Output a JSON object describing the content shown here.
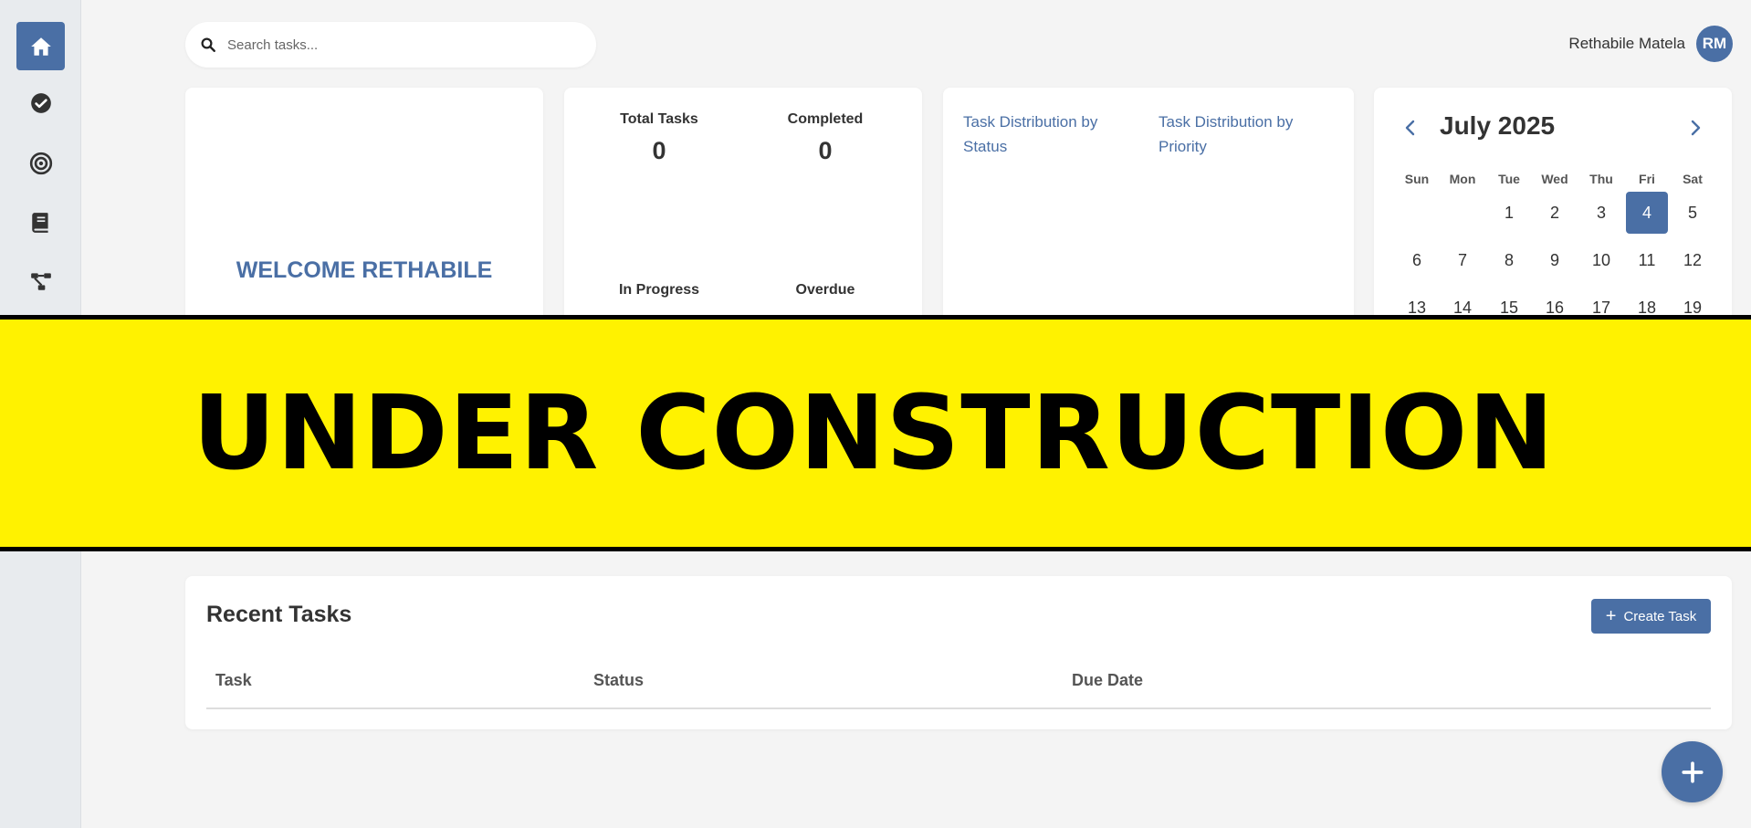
{
  "sidebar": {
    "items": [
      {
        "icon": "home-icon",
        "active": true
      },
      {
        "icon": "check-circle-icon",
        "active": false
      },
      {
        "icon": "target-icon",
        "active": false
      },
      {
        "icon": "book-icon",
        "active": false
      },
      {
        "icon": "diagram-icon",
        "active": false
      }
    ]
  },
  "search": {
    "placeholder": "Search tasks..."
  },
  "user": {
    "name": "Rethabile Matela",
    "initials": "RM"
  },
  "welcome": {
    "text": "WELCOME RETHABILE"
  },
  "stats": {
    "total_label": "Total Tasks",
    "total_value": "0",
    "completed_label": "Completed",
    "completed_value": "0",
    "in_progress_label": "In Progress",
    "overdue_label": "Overdue"
  },
  "distribution": {
    "by_status": "Task Distribution by Status",
    "by_priority": "Task Distribution by Priority"
  },
  "calendar": {
    "title": "July 2025",
    "weekdays": [
      "Sun",
      "Mon",
      "Tue",
      "Wed",
      "Thu",
      "Fri",
      "Sat"
    ],
    "week1": [
      "",
      "",
      "1",
      "2",
      "3",
      "4",
      "5"
    ],
    "week2": [
      "6",
      "7",
      "8",
      "9",
      "10",
      "11",
      "12"
    ],
    "week3": [
      "13",
      "14",
      "15",
      "16",
      "17",
      "18",
      "19"
    ],
    "today": "4"
  },
  "banner": {
    "text": "UNDER CONSTRUCTION"
  },
  "recent": {
    "title": "Recent Tasks",
    "create_label": "Create Task",
    "columns": [
      "Task",
      "Status",
      "Due Date"
    ]
  },
  "colors": {
    "accent": "#4a6fa5",
    "banner": "#fff200"
  }
}
